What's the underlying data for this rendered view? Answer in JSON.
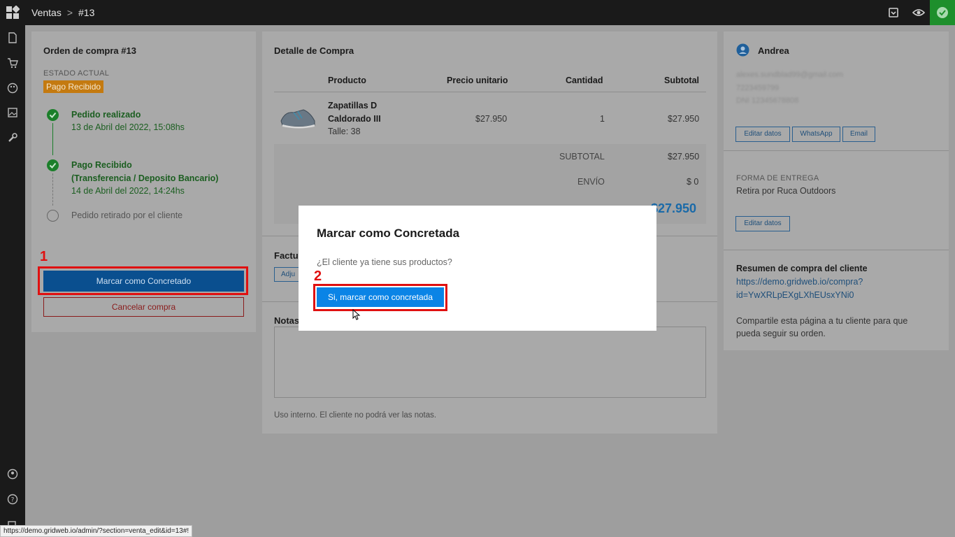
{
  "breadcrumb": {
    "section": "Ventas",
    "separator": ">",
    "current": "#13"
  },
  "topbar": {
    "icons": [
      "archive-icon",
      "eye-icon",
      "checkmark-icon"
    ]
  },
  "rail": {
    "icons": [
      "document-icon",
      "cart-icon",
      "palette-icon",
      "image-icon",
      "wrench-icon",
      "user-circle-icon",
      "help-icon",
      "external-icon"
    ]
  },
  "order": {
    "title": "Orden de compra #13",
    "state_label": "ESTADO ACTUAL",
    "state_badge": "Pago Recibido",
    "timeline": [
      {
        "title": "Pedido realizado",
        "date": "13 de Abril del 2022, 15:08hs"
      },
      {
        "title": "Pago Recibido",
        "subtitle": "(Transferencia / Deposito Bancario)",
        "date": "14 de Abril del 2022, 14:24hs"
      },
      {
        "title": "Pedido retirado por el cliente"
      }
    ],
    "mark_button": "Marcar como Concretado",
    "cancel_button": "Cancelar compra"
  },
  "annotations": {
    "one": "1",
    "two": "2"
  },
  "detail": {
    "title": "Detalle de Compra",
    "columns": [
      "Producto",
      "Precio unitario",
      "Cantidad",
      "Subtotal"
    ],
    "item": {
      "name_line1": "Zapatillas D",
      "name_line2": "Caldorado III",
      "size": "Talle: 38",
      "price": "$27.950",
      "qty": "1",
      "subtotal": "$27.950"
    },
    "subtotal_label": "SUBTOTAL",
    "subtotal_value": "$27.950",
    "shipping_label": "ENVÍO",
    "shipping_value": "$ 0",
    "total_value": "$27.950",
    "factura_label": "Factu",
    "adjuntar_label": "Adju",
    "notes_label": "Notas",
    "notes_help": "Uso interno. El cliente no podrá ver las notas."
  },
  "customer": {
    "name": "Andrea",
    "email": "alexes.sundblad99@gmail.com",
    "phone": "7223459799",
    "dni": "DNI 12345678808",
    "btn_edit": "Editar datos",
    "btn_whatsapp": "WhatsApp",
    "btn_email": "Email",
    "delivery_label": "FORMA DE ENTREGA",
    "delivery_value": "Retira por Ruca Outdoors",
    "btn_edit2": "Editar datos",
    "summary_title": "Resumen de compra del cliente",
    "summary_link1": "https://demo.gridweb.io/compra?",
    "summary_link2": "id=YwXRLpEXgLXhEUsxYNi0",
    "share_line1": "Compartile esta página a tu cliente para que",
    "share_line2": "pueda seguir su orden."
  },
  "modal": {
    "title": "Marcar como Concretada",
    "question": "¿El cliente ya tiene sus productos?",
    "confirm": "Si, marcar como concretada"
  },
  "status_url": "https://demo.gridweb.io/admin/?section=venta_edit&id=13#!"
}
